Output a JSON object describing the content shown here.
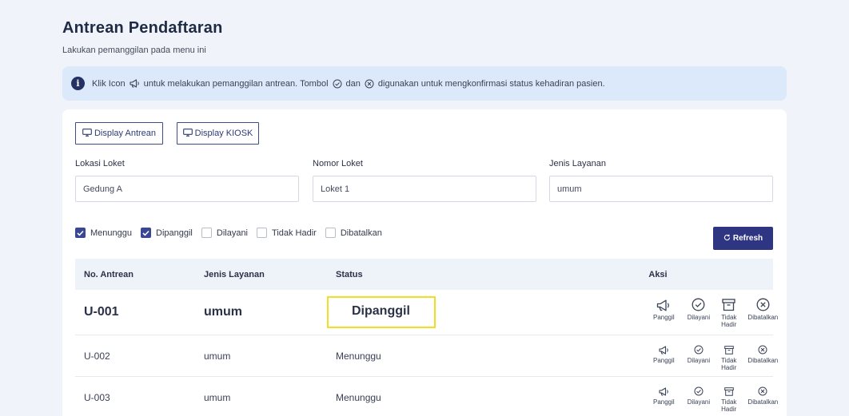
{
  "header": {
    "title": "Antrean Pendaftaran",
    "subtitle": "Lakukan pemanggilan pada menu ini"
  },
  "alert": {
    "icon": "info-icon",
    "text_part1": "Klik Icon",
    "text_part2": "untuk melakukan pemanggilan antrean. Tombol",
    "text_part3": "dan",
    "text_part4": "digunakan untuk mengkonfirmasi status kehadiran pasien."
  },
  "display_buttons": {
    "display_antrean": "Display Antrean",
    "display_kiosk": "Display KIOSK"
  },
  "fields": {
    "lokasi_loket": {
      "label": "Lokasi Loket",
      "value": "Gedung A"
    },
    "nomor_loket": {
      "label": "Nomor Loket",
      "value": "Loket 1"
    },
    "jenis_layanan": {
      "label": "Jenis Layanan",
      "value": "umum"
    }
  },
  "filters": [
    {
      "label": "Menunggu",
      "checked": true
    },
    {
      "label": "Dipanggil",
      "checked": true
    },
    {
      "label": "Dilayani",
      "checked": false
    },
    {
      "label": "Tidak Hadir",
      "checked": false
    },
    {
      "label": "Dibatalkan",
      "checked": false
    }
  ],
  "refresh_label": "Refresh",
  "table": {
    "headers": [
      "No. Antrean",
      "Jenis Layanan",
      "Status",
      "Aksi"
    ],
    "action_labels": [
      "Panggil",
      "Dilayani",
      "Tidak Hadir",
      "Dibatalkan"
    ],
    "rows": [
      {
        "no": "U-001",
        "layanan": "umum",
        "status": "Dipanggil"
      },
      {
        "no": "U-002",
        "layanan": "umum",
        "status": "Menunggu"
      },
      {
        "no": "U-003",
        "layanan": "umum",
        "status": "Menunggu"
      }
    ]
  },
  "colors": {
    "primary": "#2e3583",
    "alert_bg": "#dce9fb",
    "highlight": "#f1de24",
    "checkbox_on": "#3a4794"
  }
}
